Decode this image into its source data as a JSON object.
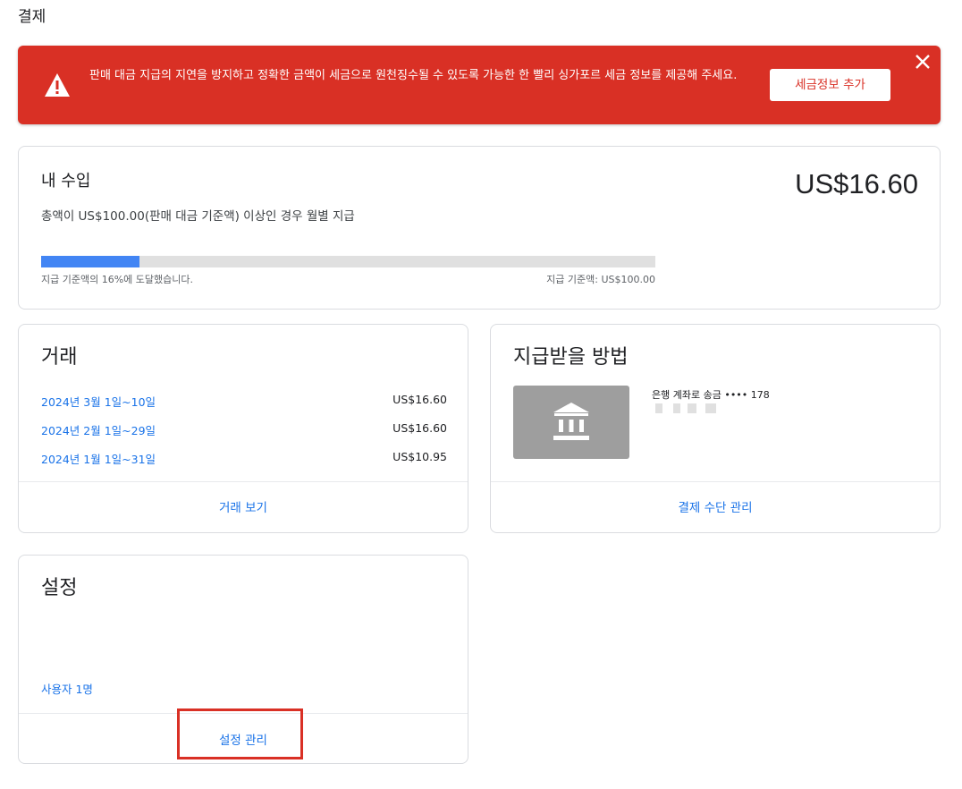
{
  "page": {
    "title": "결제"
  },
  "alert": {
    "message": "판매 대금 지급의 지연을 방지하고 정확한 금액이 세금으로 원천징수될 수 있도록 가능한 한 빨리 싱가포르 세금 정보를 제공해 주세요.",
    "button_label": "세금정보 추가",
    "icons": {
      "warning": "warning-icon",
      "close": "close-icon"
    },
    "color": "#d93025"
  },
  "earnings": {
    "title": "내 수입",
    "amount": "US$16.60",
    "description": "총액이 US$100.00(판매 대금 기준액) 이상인 경우 월별 지급",
    "progress": {
      "fraction": 0.16,
      "left_label": "지급 기준액의 16%에 도달했습니다.",
      "right_label": "지급 기준액: US$100.00"
    }
  },
  "transactions": {
    "title": "거래",
    "rows": [
      {
        "date": "2024년 3월 1일~10일",
        "value": "US$16.60"
      },
      {
        "date": "2024년 2월 1일~29일",
        "value": "US$16.60"
      },
      {
        "date": "2024년 1월 1일~31일",
        "value": "US$10.95"
      }
    ],
    "footer_link": "거래 보기"
  },
  "payment_method": {
    "title": "지급받을 방법",
    "bank_label": "은행 계좌로 송금 •••• 178",
    "bank_icon": "bank-icon",
    "footer_link": "결제 수단 관리"
  },
  "settings": {
    "title": "설정",
    "users_link": "사용자 1명",
    "footer_link": "설정 관리"
  },
  "colors": {
    "accent": "#1a73e8",
    "progress": "#4285f4",
    "danger": "#d93025"
  }
}
